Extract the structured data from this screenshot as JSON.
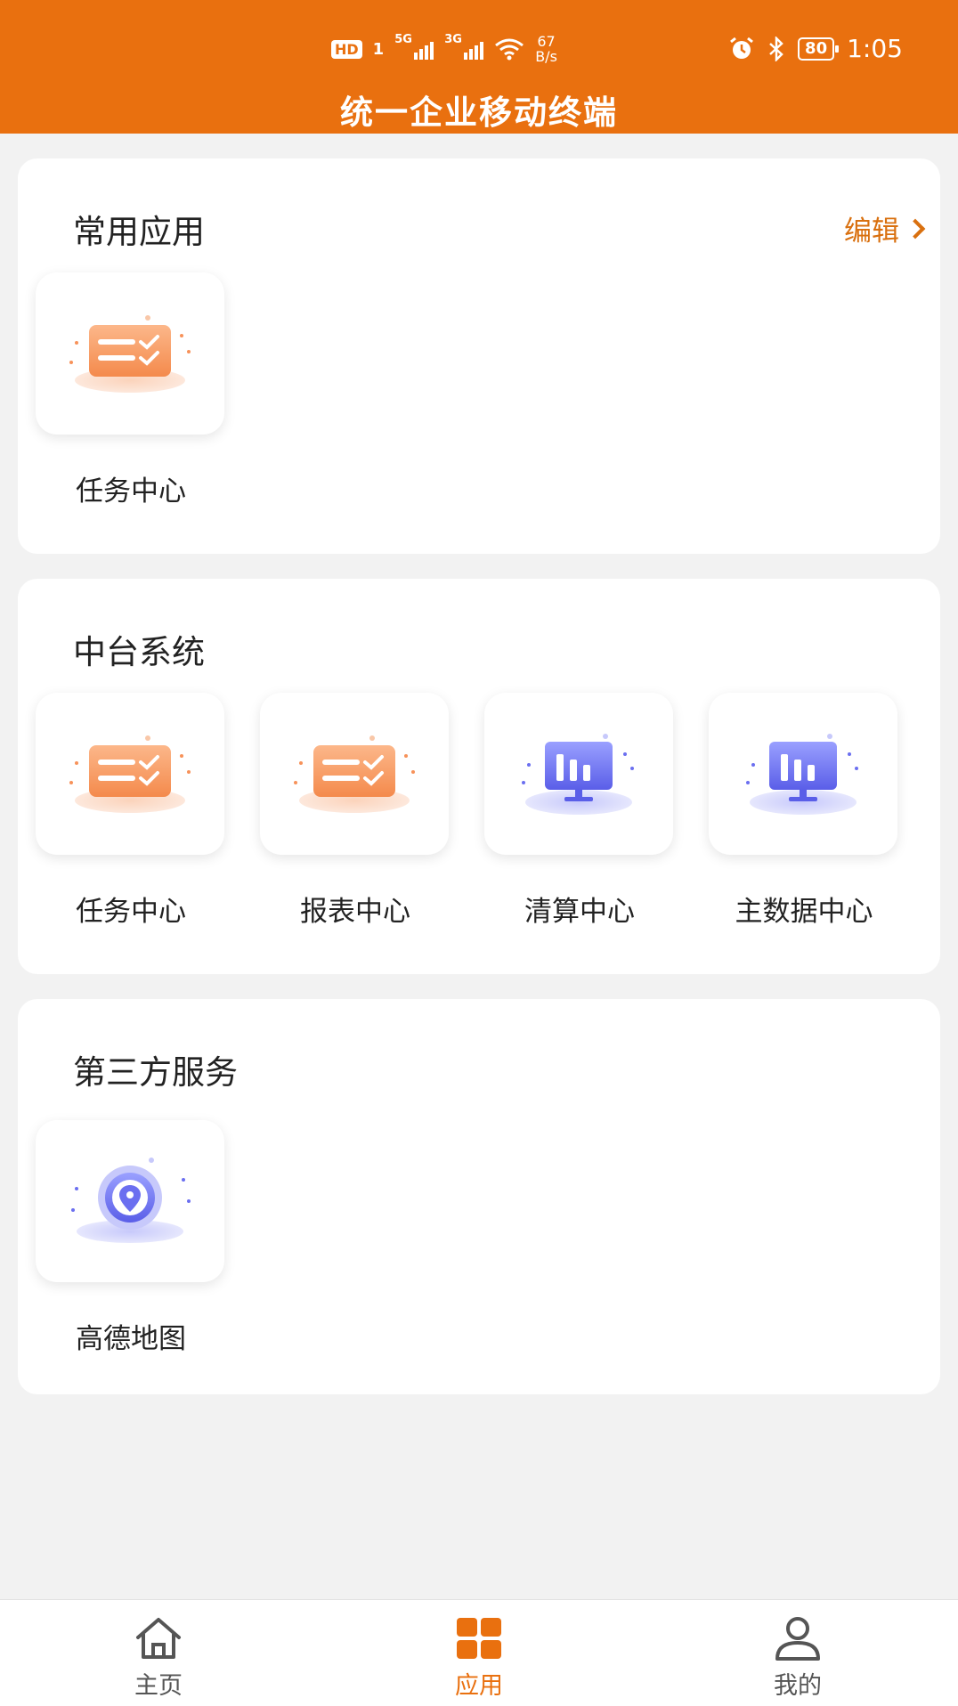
{
  "status_bar": {
    "hd": "HD",
    "sim": "1",
    "network1": "5G",
    "network2": "3G",
    "speed_value": "67",
    "speed_unit": "B/s",
    "battery": "80",
    "time": "1:05"
  },
  "header": {
    "title": "统一企业移动终端"
  },
  "sections": {
    "common": {
      "title": "常用应用",
      "edit_label": "编辑",
      "apps": [
        {
          "label": "任务中心",
          "icon": "task-center-icon"
        }
      ]
    },
    "platform": {
      "title": "中台系统",
      "apps": [
        {
          "label": "任务中心",
          "icon": "task-center-icon"
        },
        {
          "label": "报表中心",
          "icon": "report-center-icon"
        },
        {
          "label": "清算中心",
          "icon": "clearing-center-icon"
        },
        {
          "label": "主数据中心",
          "icon": "master-data-center-icon"
        }
      ]
    },
    "third_party": {
      "title": "第三方服务",
      "apps": [
        {
          "label": "高德地图",
          "icon": "amap-location-icon"
        }
      ]
    }
  },
  "tabbar": {
    "items": [
      {
        "label": "主页",
        "icon": "home-icon",
        "active": false
      },
      {
        "label": "应用",
        "icon": "apps-grid-icon",
        "active": true
      },
      {
        "label": "我的",
        "icon": "profile-icon",
        "active": false
      }
    ]
  },
  "colors": {
    "brand": "#e9700f",
    "accent_text": "#d9700f",
    "icon_orange": "#f7925a",
    "icon_purple": "#6b6ff0"
  }
}
